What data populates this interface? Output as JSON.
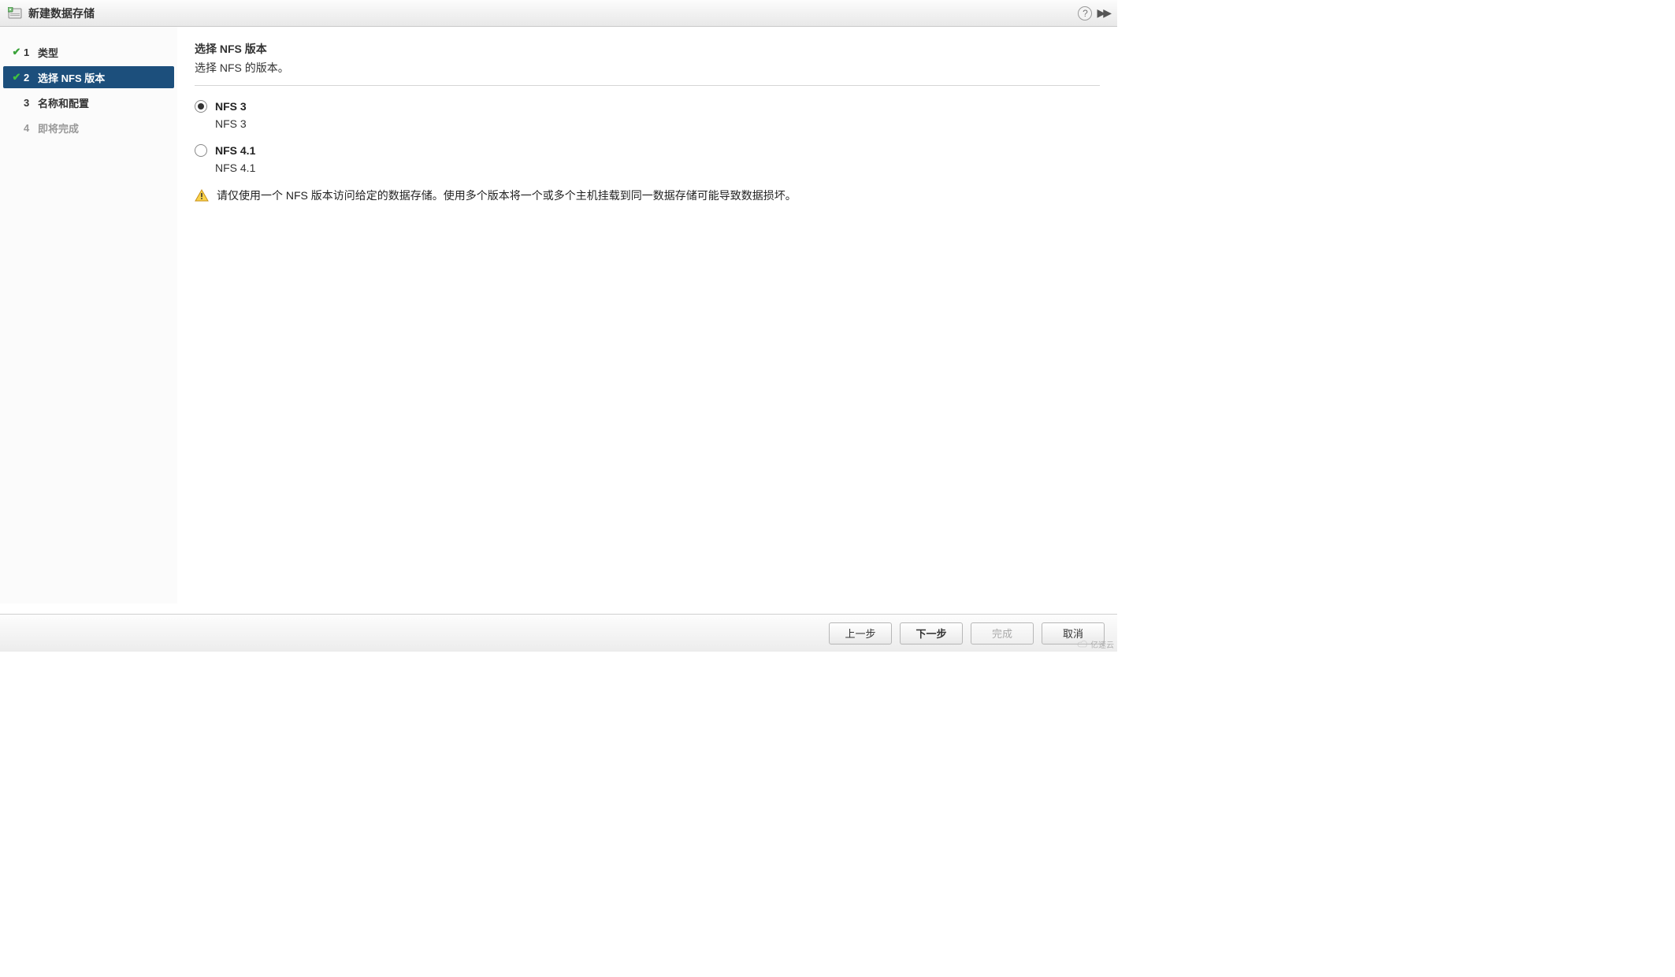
{
  "title": "新建数据存储",
  "titleActions": {
    "help": "?",
    "expand": "▶▶"
  },
  "sidebar": {
    "steps": [
      {
        "num": "1",
        "label": "类型",
        "completed": true
      },
      {
        "num": "2",
        "label": "选择 NFS 版本",
        "completed": true,
        "active": true
      },
      {
        "num": "3",
        "label": "名称和配置",
        "completed": false
      },
      {
        "num": "4",
        "label": "即将完成",
        "completed": false,
        "disabled": true
      }
    ]
  },
  "content": {
    "title": "选择 NFS 版本",
    "subtitle": "选择 NFS 的版本。",
    "options": [
      {
        "label": "NFS 3",
        "desc": "NFS 3",
        "selected": true
      },
      {
        "label": "NFS 4.1",
        "desc": "NFS 4.1",
        "selected": false
      }
    ],
    "warning": "请仅使用一个 NFS 版本访问给定的数据存储。使用多个版本将一个或多个主机挂载到同一数据存储可能导致数据损坏。"
  },
  "footer": {
    "back": "上一步",
    "next": "下一步",
    "finish": "完成",
    "cancel": "取消"
  },
  "watermark": "亿速云"
}
